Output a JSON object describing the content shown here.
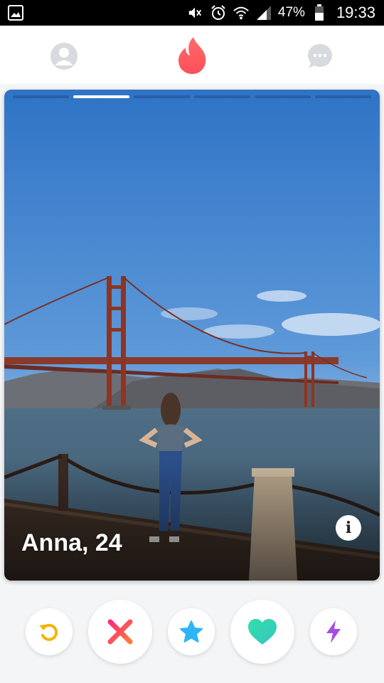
{
  "status_bar": {
    "battery_percent": "47%",
    "time": "19:33",
    "icons": [
      "gallery-icon",
      "mute-icon",
      "alarm-icon",
      "wifi-icon",
      "signal-icon",
      "battery-icon"
    ]
  },
  "header": {
    "icons": [
      "profile-icon",
      "flame-logo-icon",
      "chat-icon"
    ],
    "active_color": "#ff5a5f",
    "inactive_color": "#d7dadf"
  },
  "card": {
    "name_age": "Anna, 24",
    "photo_count": 6,
    "active_photo_index": 1
  },
  "actions": [
    {
      "name": "rewind",
      "icon": "rewind-icon",
      "color": "#f5b400"
    },
    {
      "name": "nope",
      "icon": "x-icon",
      "color": "#ff4f6d"
    },
    {
      "name": "super-like",
      "icon": "star-icon",
      "color": "#2db5f5"
    },
    {
      "name": "like",
      "icon": "heart-icon",
      "color": "#35d6b0"
    },
    {
      "name": "boost",
      "icon": "bolt-icon",
      "color": "#a64de6"
    }
  ]
}
